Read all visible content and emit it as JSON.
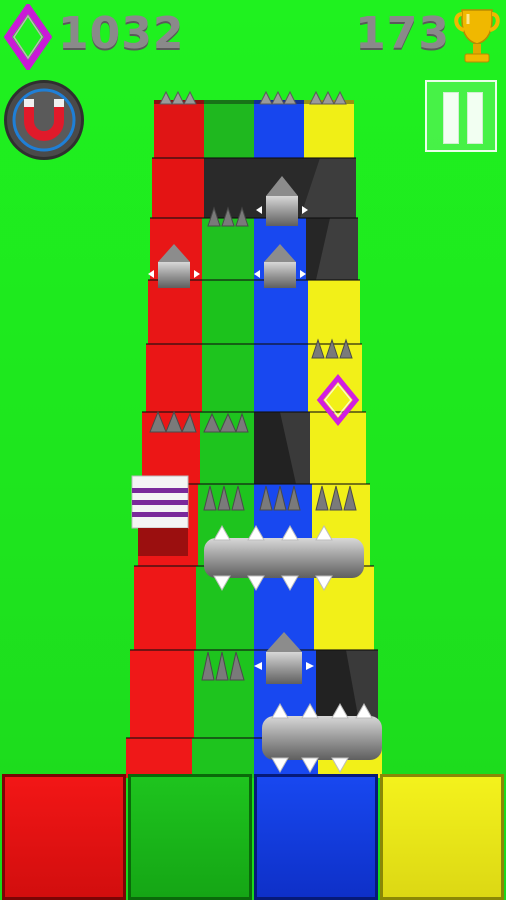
{
  "hud": {
    "gem_count": "1032",
    "best_score": "173"
  },
  "icons": {
    "gem": "diamond-outline-icon",
    "trophy": "trophy-icon",
    "magnet": "magnet-icon",
    "pause": "pause-icon"
  },
  "colors": {
    "background": "#1ee61e",
    "red": "#ee1111",
    "green": "#18c418",
    "blue": "#1646ee",
    "yellow": "#f2f21a",
    "gem": "#d21ee0",
    "trophy": "#f0b800"
  },
  "lane_buttons": [
    {
      "color": "red"
    },
    {
      "color": "green"
    },
    {
      "color": "blue"
    },
    {
      "color": "yellow"
    }
  ]
}
